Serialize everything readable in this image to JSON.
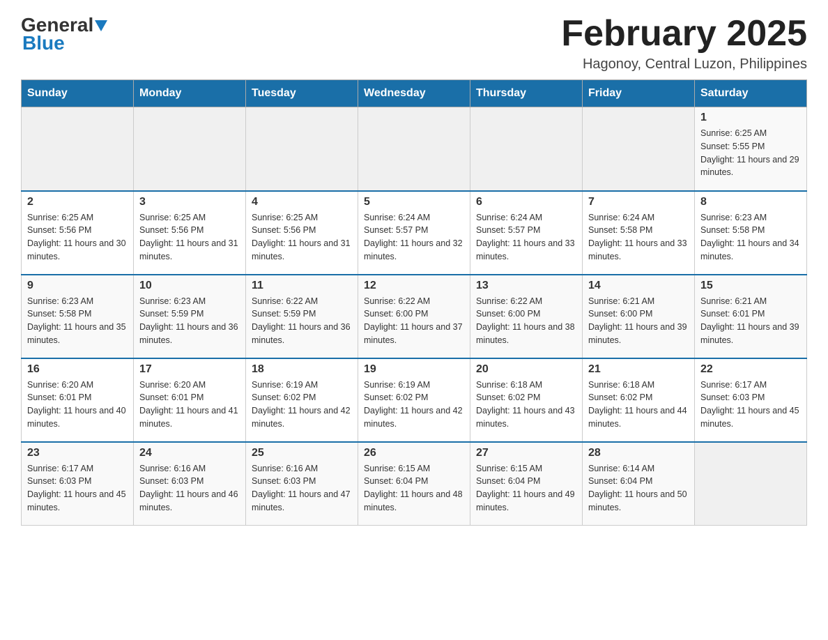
{
  "header": {
    "logo_general": "General",
    "logo_blue": "Blue",
    "title": "February 2025",
    "subtitle": "Hagonoy, Central Luzon, Philippines"
  },
  "days_of_week": [
    "Sunday",
    "Monday",
    "Tuesday",
    "Wednesday",
    "Thursday",
    "Friday",
    "Saturday"
  ],
  "weeks": [
    [
      {
        "day": "",
        "info": ""
      },
      {
        "day": "",
        "info": ""
      },
      {
        "day": "",
        "info": ""
      },
      {
        "day": "",
        "info": ""
      },
      {
        "day": "",
        "info": ""
      },
      {
        "day": "",
        "info": ""
      },
      {
        "day": "1",
        "info": "Sunrise: 6:25 AM\nSunset: 5:55 PM\nDaylight: 11 hours and 29 minutes."
      }
    ],
    [
      {
        "day": "2",
        "info": "Sunrise: 6:25 AM\nSunset: 5:56 PM\nDaylight: 11 hours and 30 minutes."
      },
      {
        "day": "3",
        "info": "Sunrise: 6:25 AM\nSunset: 5:56 PM\nDaylight: 11 hours and 31 minutes."
      },
      {
        "day": "4",
        "info": "Sunrise: 6:25 AM\nSunset: 5:56 PM\nDaylight: 11 hours and 31 minutes."
      },
      {
        "day": "5",
        "info": "Sunrise: 6:24 AM\nSunset: 5:57 PM\nDaylight: 11 hours and 32 minutes."
      },
      {
        "day": "6",
        "info": "Sunrise: 6:24 AM\nSunset: 5:57 PM\nDaylight: 11 hours and 33 minutes."
      },
      {
        "day": "7",
        "info": "Sunrise: 6:24 AM\nSunset: 5:58 PM\nDaylight: 11 hours and 33 minutes."
      },
      {
        "day": "8",
        "info": "Sunrise: 6:23 AM\nSunset: 5:58 PM\nDaylight: 11 hours and 34 minutes."
      }
    ],
    [
      {
        "day": "9",
        "info": "Sunrise: 6:23 AM\nSunset: 5:58 PM\nDaylight: 11 hours and 35 minutes."
      },
      {
        "day": "10",
        "info": "Sunrise: 6:23 AM\nSunset: 5:59 PM\nDaylight: 11 hours and 36 minutes."
      },
      {
        "day": "11",
        "info": "Sunrise: 6:22 AM\nSunset: 5:59 PM\nDaylight: 11 hours and 36 minutes."
      },
      {
        "day": "12",
        "info": "Sunrise: 6:22 AM\nSunset: 6:00 PM\nDaylight: 11 hours and 37 minutes."
      },
      {
        "day": "13",
        "info": "Sunrise: 6:22 AM\nSunset: 6:00 PM\nDaylight: 11 hours and 38 minutes."
      },
      {
        "day": "14",
        "info": "Sunrise: 6:21 AM\nSunset: 6:00 PM\nDaylight: 11 hours and 39 minutes."
      },
      {
        "day": "15",
        "info": "Sunrise: 6:21 AM\nSunset: 6:01 PM\nDaylight: 11 hours and 39 minutes."
      }
    ],
    [
      {
        "day": "16",
        "info": "Sunrise: 6:20 AM\nSunset: 6:01 PM\nDaylight: 11 hours and 40 minutes."
      },
      {
        "day": "17",
        "info": "Sunrise: 6:20 AM\nSunset: 6:01 PM\nDaylight: 11 hours and 41 minutes."
      },
      {
        "day": "18",
        "info": "Sunrise: 6:19 AM\nSunset: 6:02 PM\nDaylight: 11 hours and 42 minutes."
      },
      {
        "day": "19",
        "info": "Sunrise: 6:19 AM\nSunset: 6:02 PM\nDaylight: 11 hours and 42 minutes."
      },
      {
        "day": "20",
        "info": "Sunrise: 6:18 AM\nSunset: 6:02 PM\nDaylight: 11 hours and 43 minutes."
      },
      {
        "day": "21",
        "info": "Sunrise: 6:18 AM\nSunset: 6:02 PM\nDaylight: 11 hours and 44 minutes."
      },
      {
        "day": "22",
        "info": "Sunrise: 6:17 AM\nSunset: 6:03 PM\nDaylight: 11 hours and 45 minutes."
      }
    ],
    [
      {
        "day": "23",
        "info": "Sunrise: 6:17 AM\nSunset: 6:03 PM\nDaylight: 11 hours and 45 minutes."
      },
      {
        "day": "24",
        "info": "Sunrise: 6:16 AM\nSunset: 6:03 PM\nDaylight: 11 hours and 46 minutes."
      },
      {
        "day": "25",
        "info": "Sunrise: 6:16 AM\nSunset: 6:03 PM\nDaylight: 11 hours and 47 minutes."
      },
      {
        "day": "26",
        "info": "Sunrise: 6:15 AM\nSunset: 6:04 PM\nDaylight: 11 hours and 48 minutes."
      },
      {
        "day": "27",
        "info": "Sunrise: 6:15 AM\nSunset: 6:04 PM\nDaylight: 11 hours and 49 minutes."
      },
      {
        "day": "28",
        "info": "Sunrise: 6:14 AM\nSunset: 6:04 PM\nDaylight: 11 hours and 50 minutes."
      },
      {
        "day": "",
        "info": ""
      }
    ]
  ]
}
